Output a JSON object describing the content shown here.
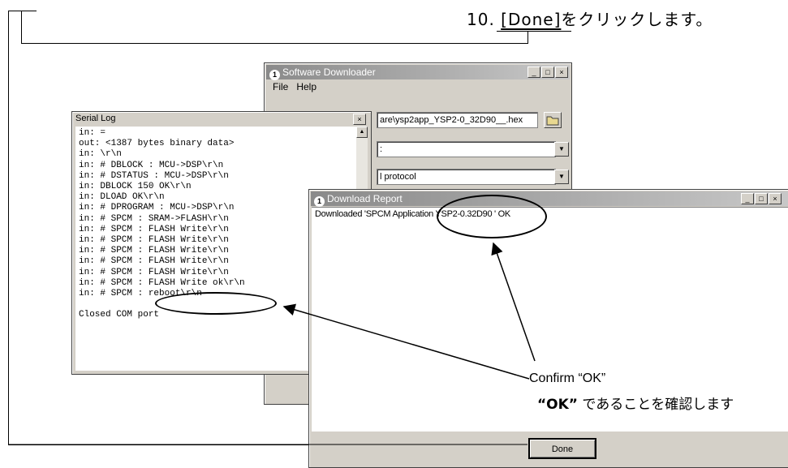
{
  "step": {
    "number": "10.",
    "key": "[Done]",
    "text": "をクリックします。"
  },
  "downloader": {
    "title": "Software Downloader",
    "menu": [
      {
        "label": "File",
        "mnemonic": "F"
      },
      {
        "label": "Help",
        "mnemonic": "H"
      }
    ],
    "file_path": "are\\ysp2app_YSP2-0_32D90__.hex",
    "field2": ":",
    "field3": "l protocol"
  },
  "serial_log": {
    "title": "Serial Log",
    "lines": [
      "in: =",
      "out: <1387 bytes binary data>",
      "in: \\r\\n",
      "in: # DBLOCK : MCU->DSP\\r\\n",
      "in: # DSTATUS : MCU->DSP\\r\\n",
      "in: DBLOCK 150 OK\\r\\n",
      "in: DLOAD OK\\r\\n",
      "in: # DPROGRAM : MCU->DSP\\r\\n",
      "in: # SPCM : SRAM->FLASH\\r\\n",
      "in: # SPCM : FLASH Write\\r\\n",
      "in: # SPCM : FLASH Write\\r\\n",
      "in: # SPCM : FLASH Write\\r\\n",
      "in: # SPCM : FLASH Write\\r\\n",
      "in: # SPCM : FLASH Write\\r\\n",
      "in: # SPCM : FLASH Write ok\\r\\n",
      "in: # SPCM : reboot\\r\\n",
      "",
      "Closed COM port"
    ]
  },
  "report": {
    "title": "Download Report",
    "line": "Downloaded 'SPCM Application YSP2-0.32D90 ' OK",
    "done_label": "Done"
  },
  "annotation": {
    "confirm_en": "Confirm “OK”",
    "confirm_ja_quote": "“OK”",
    "confirm_ja_rest": " であることを確認します"
  },
  "icons": {
    "app": "app-logo-icon",
    "folder": "folder-open-icon",
    "dropdown": "chevron-down-icon",
    "minimize": "minimize-icon",
    "maximize": "maximize-icon",
    "close": "close-icon"
  }
}
